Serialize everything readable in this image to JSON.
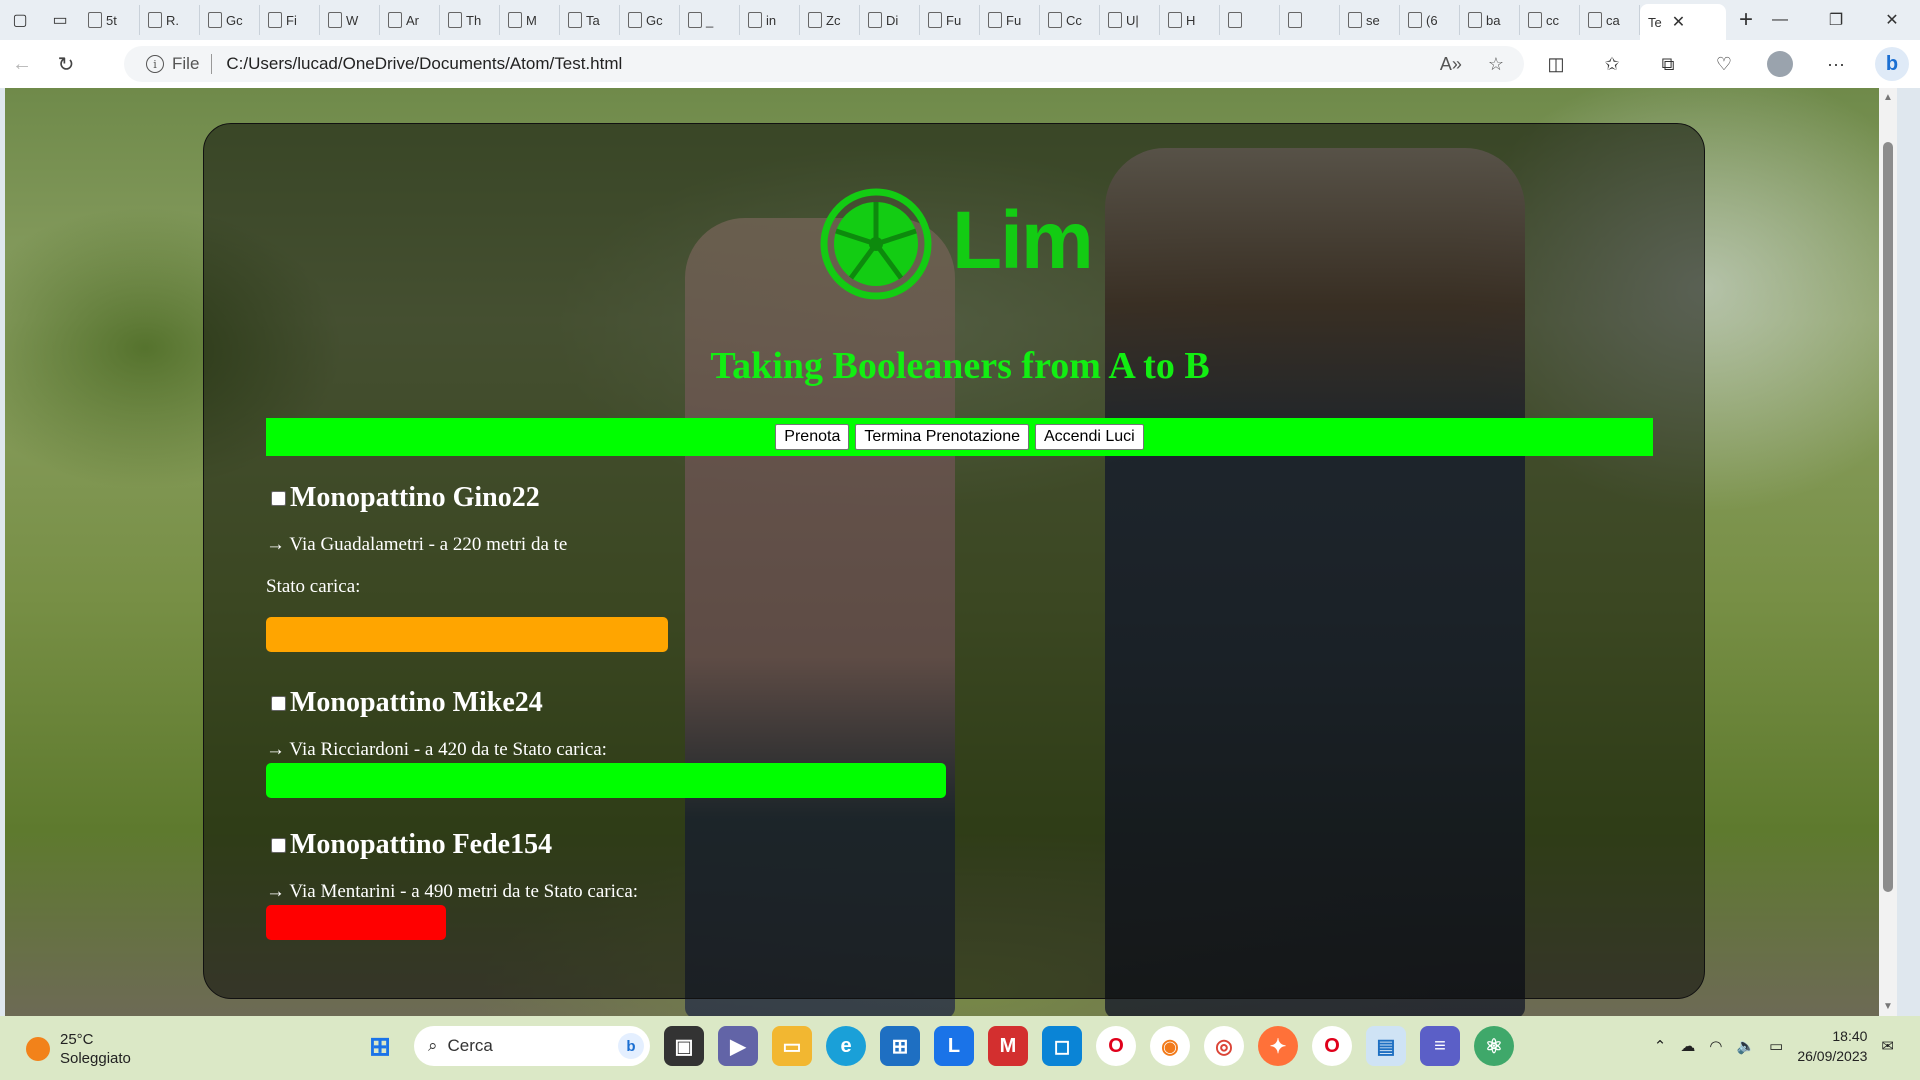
{
  "browser": {
    "tabs": [
      {
        "label": "5t",
        "icon": "page-icon"
      },
      {
        "label": "R.",
        "icon": "page-icon"
      },
      {
        "label": "Gc",
        "icon": "page-icon"
      },
      {
        "label": "Fi",
        "icon": "game-icon"
      },
      {
        "label": "W",
        "icon": "page-icon"
      },
      {
        "label": "Ar",
        "icon": "page-icon"
      },
      {
        "label": "Th",
        "icon": "page-icon"
      },
      {
        "label": "M",
        "icon": "page-icon"
      },
      {
        "label": "Ta",
        "icon": "ai-icon"
      },
      {
        "label": "Gc",
        "icon": "mc-icon"
      },
      {
        "label": "_",
        "icon": "tabs-icon"
      },
      {
        "label": "in",
        "icon": "page-icon"
      },
      {
        "label": "Zc",
        "icon": "image-icon"
      },
      {
        "label": "Di",
        "icon": "image-icon"
      },
      {
        "label": "Fu",
        "icon": "diamond-icon"
      },
      {
        "label": "Fu",
        "icon": "diamond-icon"
      },
      {
        "label": "Cc",
        "icon": "dark-icon"
      },
      {
        "label": "U|",
        "icon": "github-icon"
      },
      {
        "label": "H",
        "icon": "reddit-icon"
      },
      {
        "label": "",
        "icon": "gmail-icon"
      },
      {
        "label": "",
        "icon": "pin-icon"
      },
      {
        "label": "se",
        "icon": "search-icon"
      },
      {
        "label": "(6",
        "icon": "g-icon"
      },
      {
        "label": "ba",
        "icon": "page-icon"
      },
      {
        "label": "cc",
        "icon": "search-icon"
      },
      {
        "label": "ca",
        "icon": "search-icon"
      }
    ],
    "active_tab": {
      "label": "Te",
      "close": "✕"
    },
    "new_tab": "+",
    "address": {
      "scheme": "File",
      "url": "C:/Users/lucad/OneDrive/Documents/Atom/Test.html"
    }
  },
  "page": {
    "logo_text": "Lim",
    "tagline": "Taking Booleaners from A to B",
    "buttons": [
      "Prenota",
      "Termina Prenotazione",
      "Accendi Luci"
    ],
    "scooters": [
      {
        "name": "Monopattino Gino22",
        "location": "→ Via Guadalametri - a 220 metri da te",
        "battery_label": "Stato carica:",
        "battery_color": "#ffa500",
        "battery_fraction": 0.29
      },
      {
        "name": "Monopattino Mike24",
        "location": "→ Via Ricciardoni - a 420 da te Stato carica:",
        "battery_label": "",
        "battery_color": "#00ff00",
        "battery_fraction": 0.49
      },
      {
        "name": "Monopattino Fede154",
        "location": "→ Via Mentarini - a 490 metri da te Stato carica:",
        "battery_label": "",
        "battery_color": "#ff0000",
        "battery_fraction": 0.13
      }
    ],
    "colors": {
      "brand": "#13cc13",
      "tagline": "#12ee12",
      "bar": "#00ff00"
    }
  },
  "taskbar": {
    "weather": {
      "temp": "25°C",
      "desc": "Soleggiato"
    },
    "search_placeholder": "Cerca",
    "time": "18:40",
    "date": "26/09/2023"
  }
}
